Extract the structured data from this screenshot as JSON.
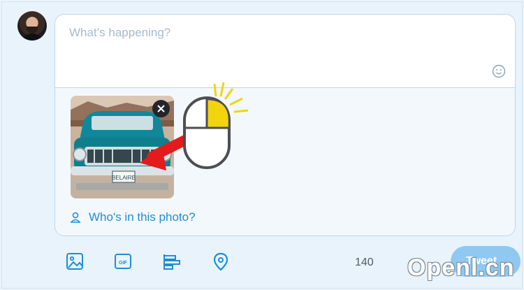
{
  "composer": {
    "placeholder": "What’s happening?"
  },
  "media": {
    "photo_plate_text": "BELAIRE",
    "tag_people_label": "Who's in this photo?"
  },
  "toolbar": {
    "icons": [
      "image-icon",
      "gif-icon",
      "poll-icon",
      "location-icon"
    ],
    "gif_label": "GIF"
  },
  "tweet": {
    "remaining_count": "140",
    "button_label": "Tweet"
  },
  "watermark": {
    "text": "Openl.cn"
  },
  "colors": {
    "accent": "#1d8ed6",
    "tweet_button": "#8fc9f2",
    "pointer_arrow": "#e31b1b",
    "mouse_highlight": "#f2d40f"
  }
}
